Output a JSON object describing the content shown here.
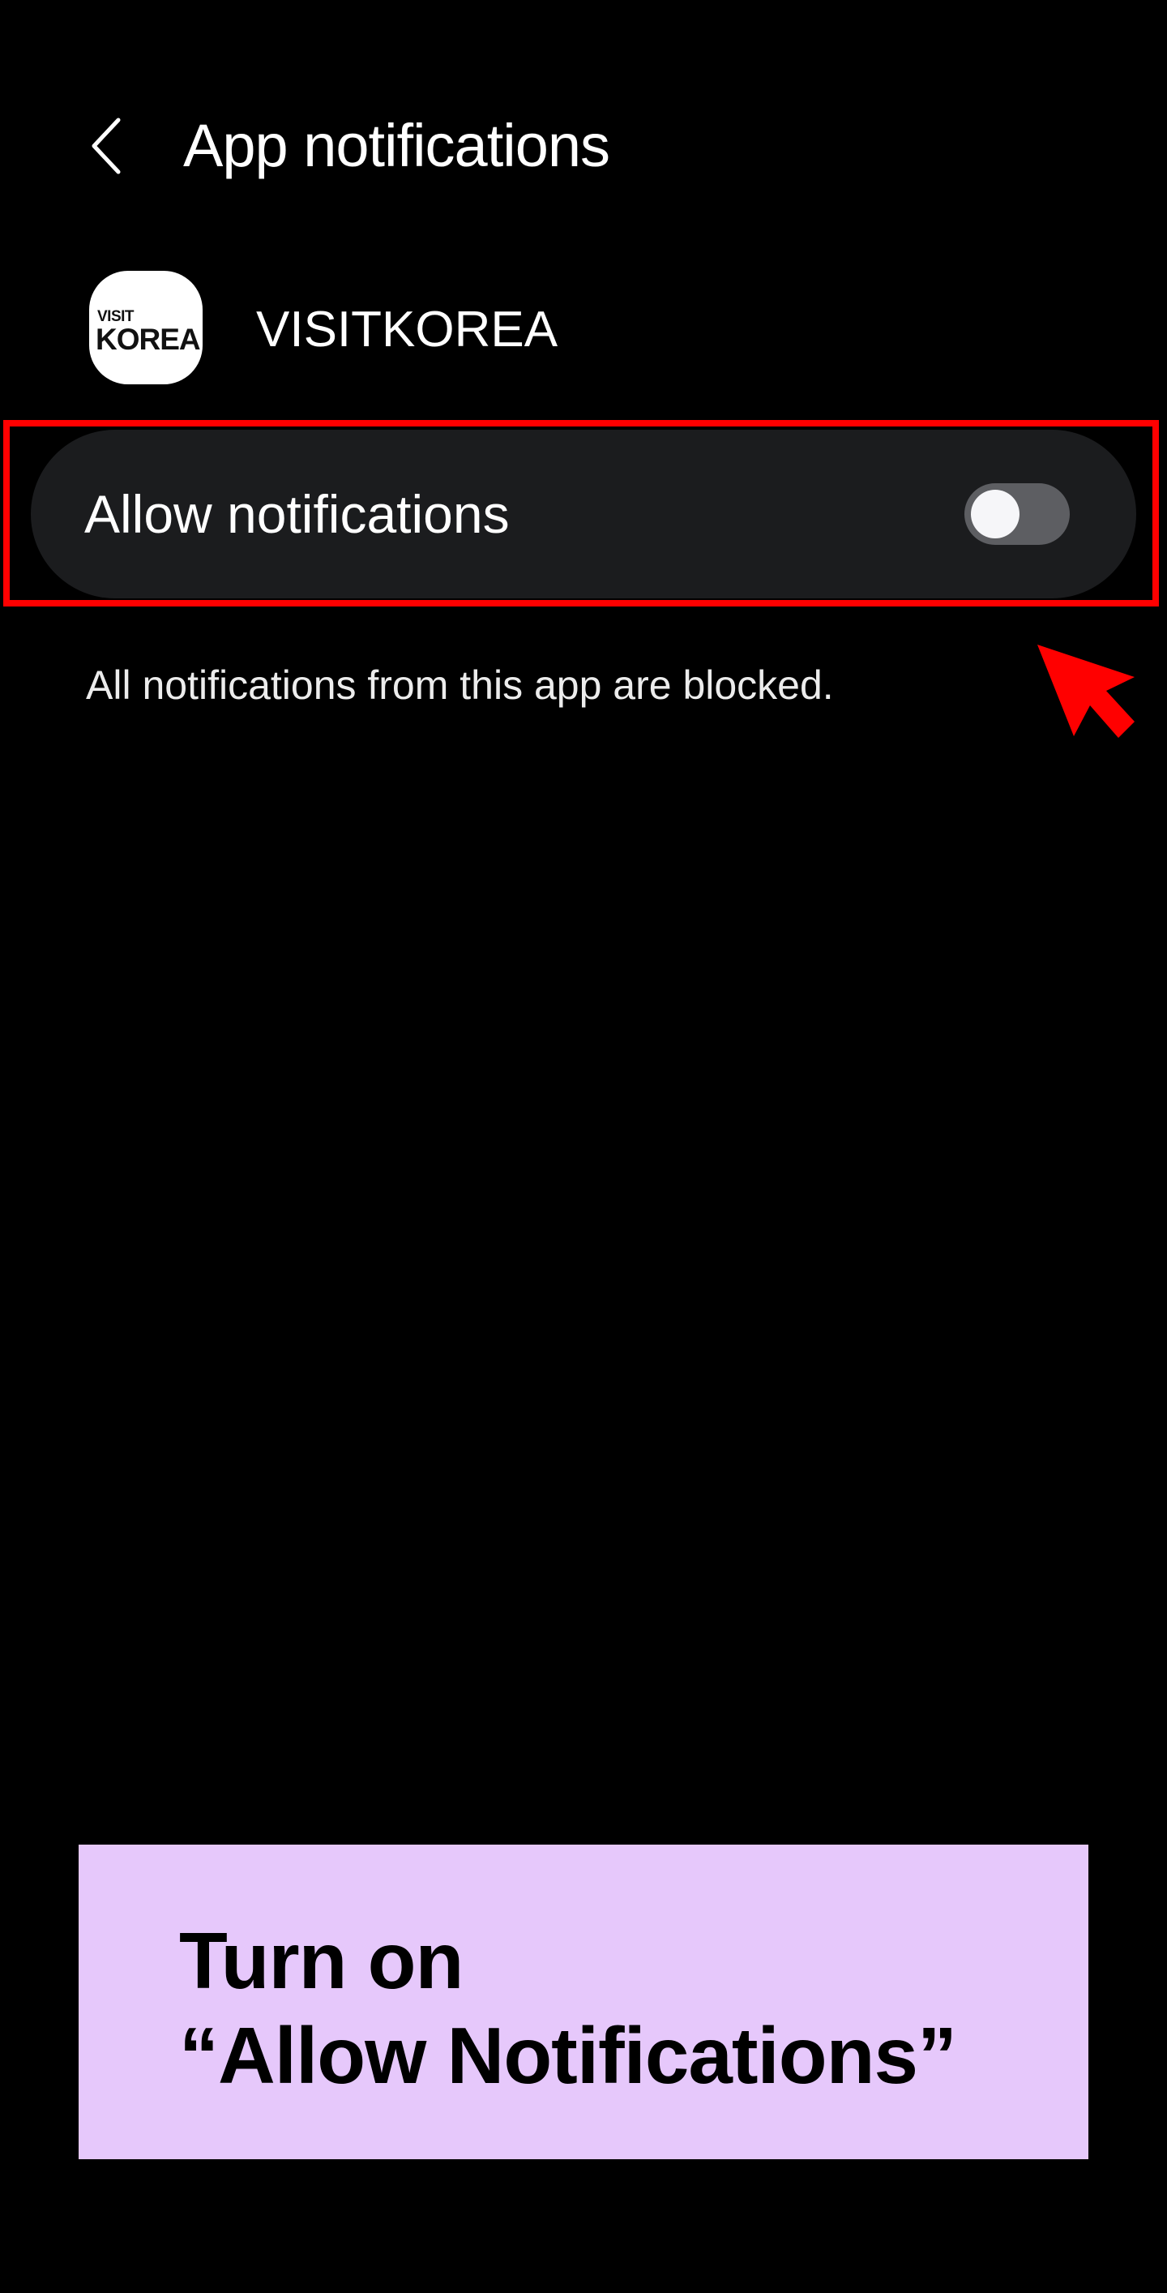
{
  "header": {
    "back_icon": "chevron-left-icon",
    "title": "App notifications"
  },
  "app": {
    "icon_small_text": "VISIT",
    "icon_big_text": "KOREA",
    "name": "VISITKOREA"
  },
  "allow_notifications": {
    "label": "Allow notifications",
    "enabled": false,
    "status_text": "All notifications from this app are blocked."
  },
  "annotation": {
    "highlight_color": "#ff0000",
    "pointer_icon": "arrow-pointer-icon"
  },
  "banner": {
    "line1": "Turn on",
    "line2": "“Allow Notifications”",
    "background": "#e6c8fb"
  }
}
